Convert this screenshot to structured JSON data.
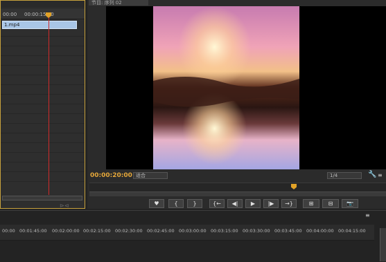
{
  "left_panel": {
    "ruler_labels": [
      "00:00",
      "00:00:15:00"
    ],
    "clip_label": "1.mp4"
  },
  "monitor": {
    "tab_label": "节目: 序列 02",
    "timecode": "00:00:20:00",
    "fit_dropdown": "适合",
    "quality_dropdown": "1/4"
  },
  "transport": {
    "buttons": [
      "♥",
      "{",
      "}",
      "{←",
      "◀|",
      "▶",
      "|▶",
      "→}",
      "⊞",
      "⊟",
      "📷"
    ]
  },
  "bottom_timeline": {
    "ruler_labels": [
      "00:00",
      "00:01:45:00",
      "00:02:00:00",
      "00:02:15:00",
      "00:02:30:00",
      "00:02:45:00",
      "00:03:00:00",
      "00:03:15:00",
      "00:03:30:00",
      "00:03:45:00",
      "00:04:00:00",
      "00:04:15:00"
    ]
  }
}
